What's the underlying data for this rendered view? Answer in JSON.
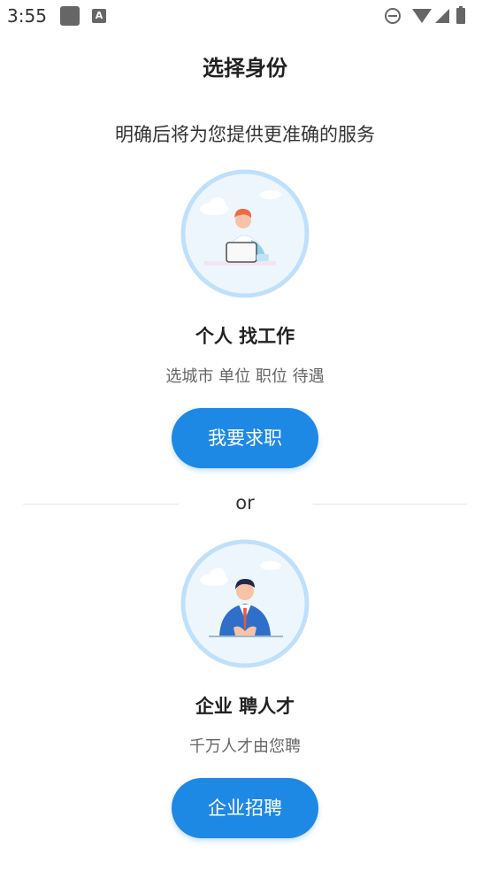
{
  "status_bar": {
    "time": "3:55",
    "notification_letter": "A"
  },
  "page_title": "选择身份",
  "subtitle": "明确后将为您提供更准确的服务",
  "personal": {
    "title": "个人 找工作",
    "description": "选城市 单位 职位 待遇",
    "button_label": "我要求职"
  },
  "divider": {
    "label": "or"
  },
  "enterprise": {
    "title": "企业 聘人才",
    "description": "千万人才由您聘",
    "button_label": "企业招聘"
  },
  "colors": {
    "accent": "#1e88e5",
    "avatar_ring": "#bfe0fb",
    "avatar_bg": "#eef6fd"
  }
}
